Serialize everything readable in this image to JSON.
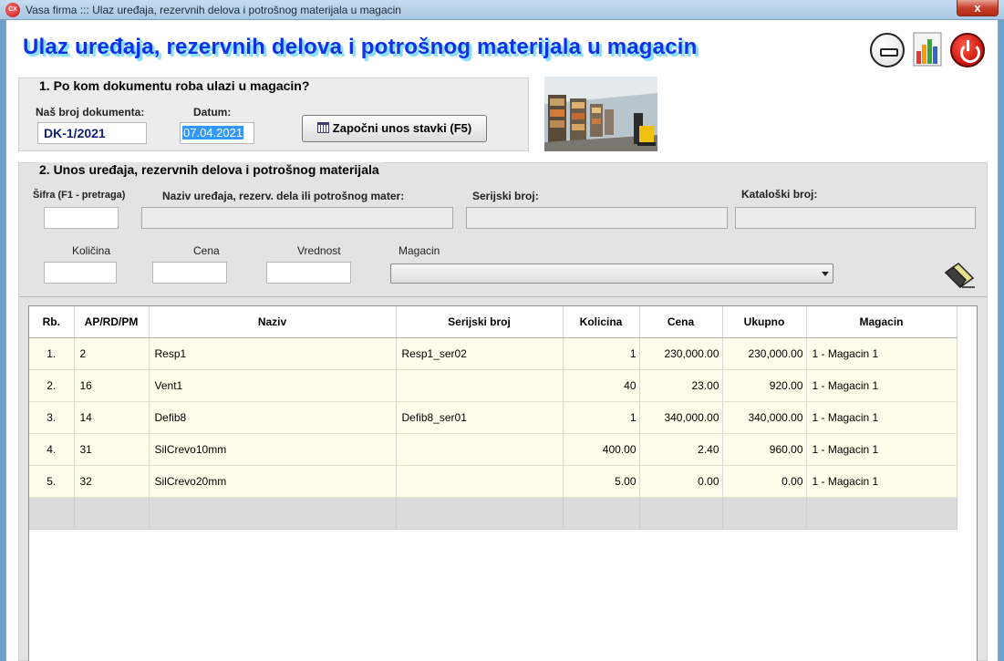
{
  "window": {
    "title": "Vasa firma ::: Ulaz uređaja, rezervnih delova i potrošnog materijala u magacin",
    "app_icon": "CX",
    "close_label": "x"
  },
  "page": {
    "title": "Ulaz uređaja, rezervnih delova i potrošnog materijala u magacin"
  },
  "section1": {
    "title": "1.  Po kom dokumentu roba ulazi u magacin?",
    "doc_label": "Naš broj dokumenta:",
    "doc_value": "DK-1/2021",
    "date_label": "Datum:",
    "date_value": "07.04.2021",
    "start_button": "Započni unos stavki (F5)"
  },
  "section2": {
    "title": "2. Unos uređaja, rezervnih delova i potrošnog materijala",
    "sifra_label": "Šifra (F1 - pretraga)",
    "naziv_label": "Naziv uređaja, rezerv. dela ili potrošnog mater:",
    "serijski_label": "Serijski broj:",
    "katalog_label": "Kataloški broj:",
    "kolicina_label": "Količina",
    "cena_label": "Cena",
    "vrednost_label": "Vrednost",
    "magacin_label": "Magacin"
  },
  "grid": {
    "columns": [
      "Rb.",
      "AP/RD/PM",
      "Naziv",
      "Serijski broj",
      "Kolicina",
      "Cena",
      "Ukupno",
      "Magacin"
    ],
    "rows": [
      [
        "1.",
        "2",
        "Resp1",
        "Resp1_ser02",
        "1",
        "230,000.00",
        "230,000.00",
        "1 - Magacin 1"
      ],
      [
        "2.",
        "16",
        "Vent1",
        "",
        "40",
        "23.00",
        "920.00",
        "1 - Magacin 1"
      ],
      [
        "3.",
        "14",
        "Defib8",
        "Defib8_ser01",
        "1",
        "340,000.00",
        "340,000.00",
        "1 - Magacin 1"
      ],
      [
        "4.",
        "31",
        "SilCrevo10mm",
        "",
        "400.00",
        "2.40",
        "960.00",
        "1 - Magacin 1"
      ],
      [
        "5.",
        "32",
        "SilCrevo20mm",
        "",
        "5.00",
        "0.00",
        "0.00",
        "1 - Magacin 1"
      ]
    ]
  },
  "colors": {
    "title_blue": "#1430e6",
    "title_shadow": "#86e4ff",
    "row_bg": "#fdfde9",
    "panel_bg": "#e3e3e3"
  }
}
